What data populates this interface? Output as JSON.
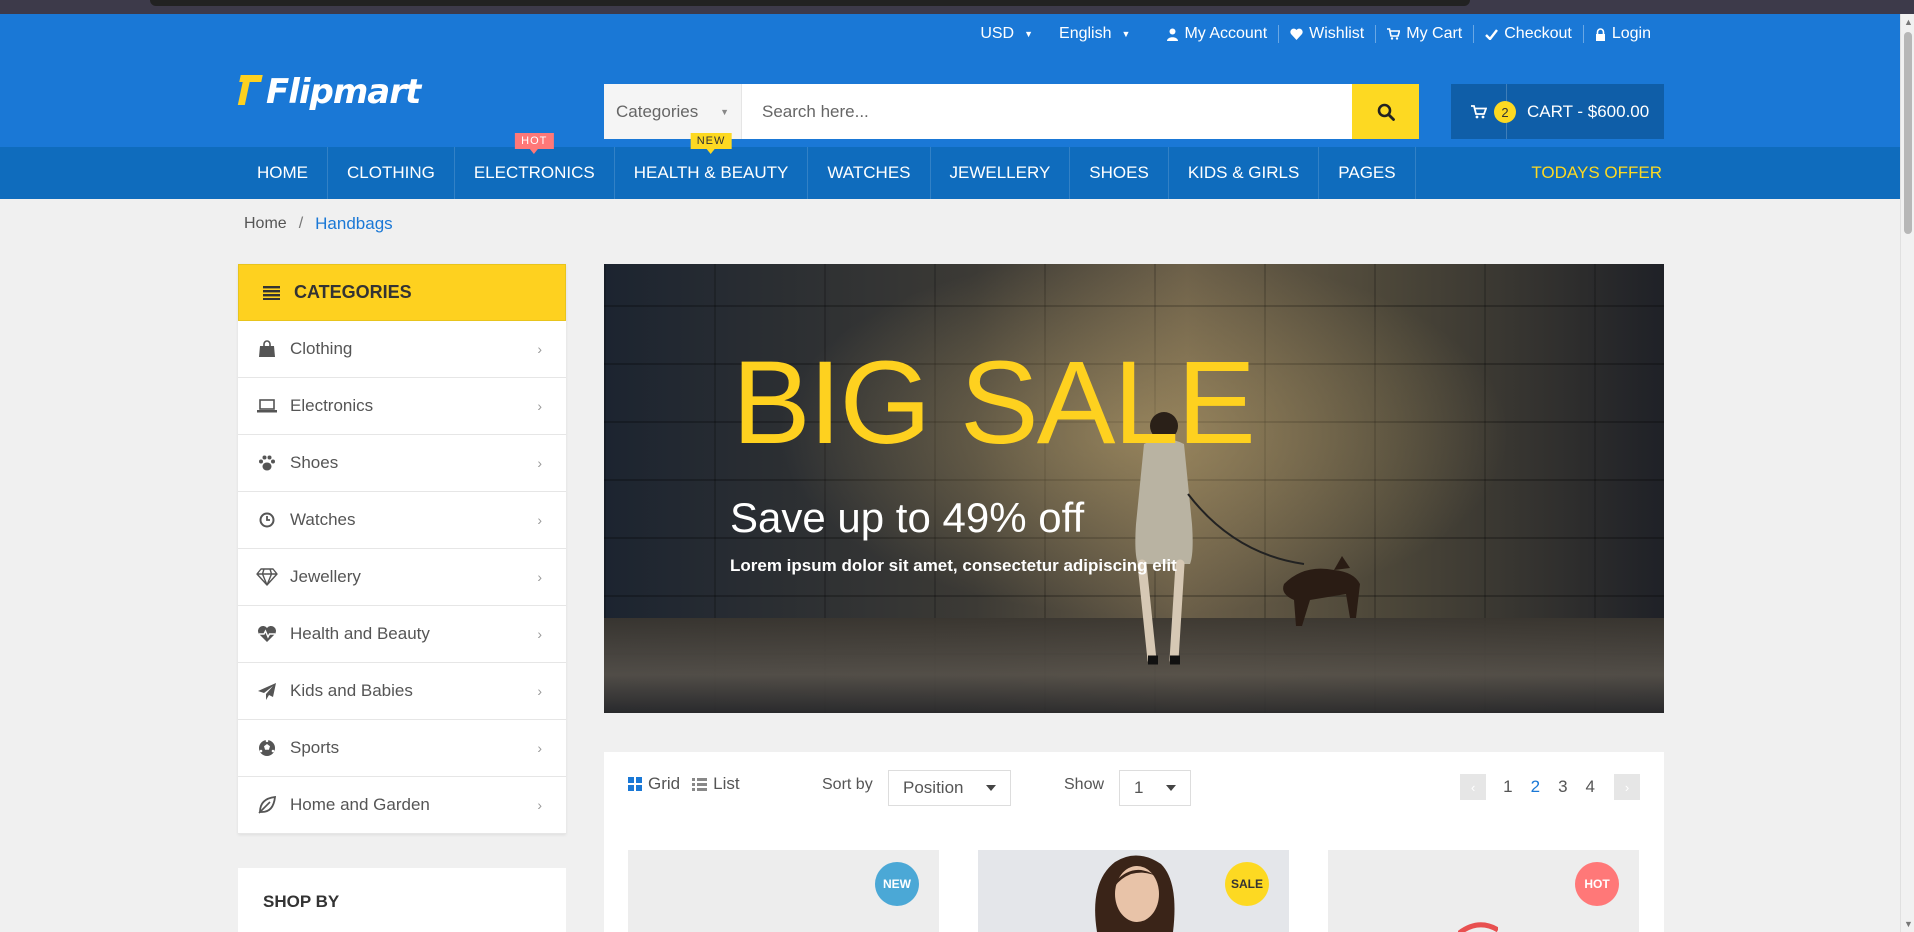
{
  "topbar": {
    "currency": "USD",
    "language": "English",
    "links": [
      {
        "icon": "user-icon",
        "label": "My Account"
      },
      {
        "icon": "heart-icon",
        "label": "Wishlist"
      },
      {
        "icon": "cart-icon",
        "label": "My Cart"
      },
      {
        "icon": "check-icon",
        "label": "Checkout"
      },
      {
        "icon": "lock-icon",
        "label": "Login"
      }
    ]
  },
  "logo": {
    "text": "Flipmart"
  },
  "search": {
    "category": "Categories",
    "placeholder": "Search here..."
  },
  "cart": {
    "count": "2",
    "label": "CART - $600.00"
  },
  "nav": {
    "items": [
      {
        "label": "HOME",
        "tag": ""
      },
      {
        "label": "CLOTHING",
        "tag": ""
      },
      {
        "label": "ELECTRONICS",
        "tag": "HOT"
      },
      {
        "label": "HEALTH & BEAUTY",
        "tag": "NEW"
      },
      {
        "label": "WATCHES",
        "tag": ""
      },
      {
        "label": "JEWELLERY",
        "tag": ""
      },
      {
        "label": "SHOES",
        "tag": ""
      },
      {
        "label": "KIDS & GIRLS",
        "tag": ""
      },
      {
        "label": "PAGES",
        "tag": ""
      }
    ],
    "offer": "TODAYS OFFER"
  },
  "breadcrumb": {
    "home": "Home",
    "sep": "/",
    "current": "Handbags"
  },
  "sidebar": {
    "title": "CATEGORIES",
    "items": [
      {
        "label": "Clothing",
        "icon": "shopping-bag-icon"
      },
      {
        "label": "Electronics",
        "icon": "laptop-icon"
      },
      {
        "label": "Shoes",
        "icon": "paw-icon"
      },
      {
        "label": "Watches",
        "icon": "clock-icon"
      },
      {
        "label": "Jewellery",
        "icon": "diamond-icon"
      },
      {
        "label": "Health and Beauty",
        "icon": "heartbeat-icon"
      },
      {
        "label": "Kids and Babies",
        "icon": "paper-plane-icon"
      },
      {
        "label": "Sports",
        "icon": "soccer-ball-icon"
      },
      {
        "label": "Home and Garden",
        "icon": "leaf-icon"
      }
    ],
    "shop_by": "SHOP BY"
  },
  "banner": {
    "headline": "BIG SALE",
    "subhead": "Save up to 49% off",
    "text": "Lorem ipsum dolor sit amet, consectetur adipiscing elit"
  },
  "toolbar": {
    "grid_label": "Grid",
    "list_label": "List",
    "sort_label": "Sort by",
    "sort_value": "Position",
    "show_label": "Show",
    "show_value": "1",
    "pages": [
      "1",
      "2",
      "3",
      "4"
    ],
    "active_page": "2"
  },
  "products": [
    {
      "badge": "NEW",
      "color": "#4ba8d6"
    },
    {
      "badge": "SALE",
      "color": "#fdd922"
    },
    {
      "badge": "HOT",
      "color": "#ff7878"
    }
  ],
  "colors": {
    "primary": "#1a78d6",
    "nav": "#0f6cbd",
    "accent": "#fed11f",
    "hot": "#ff7878"
  }
}
